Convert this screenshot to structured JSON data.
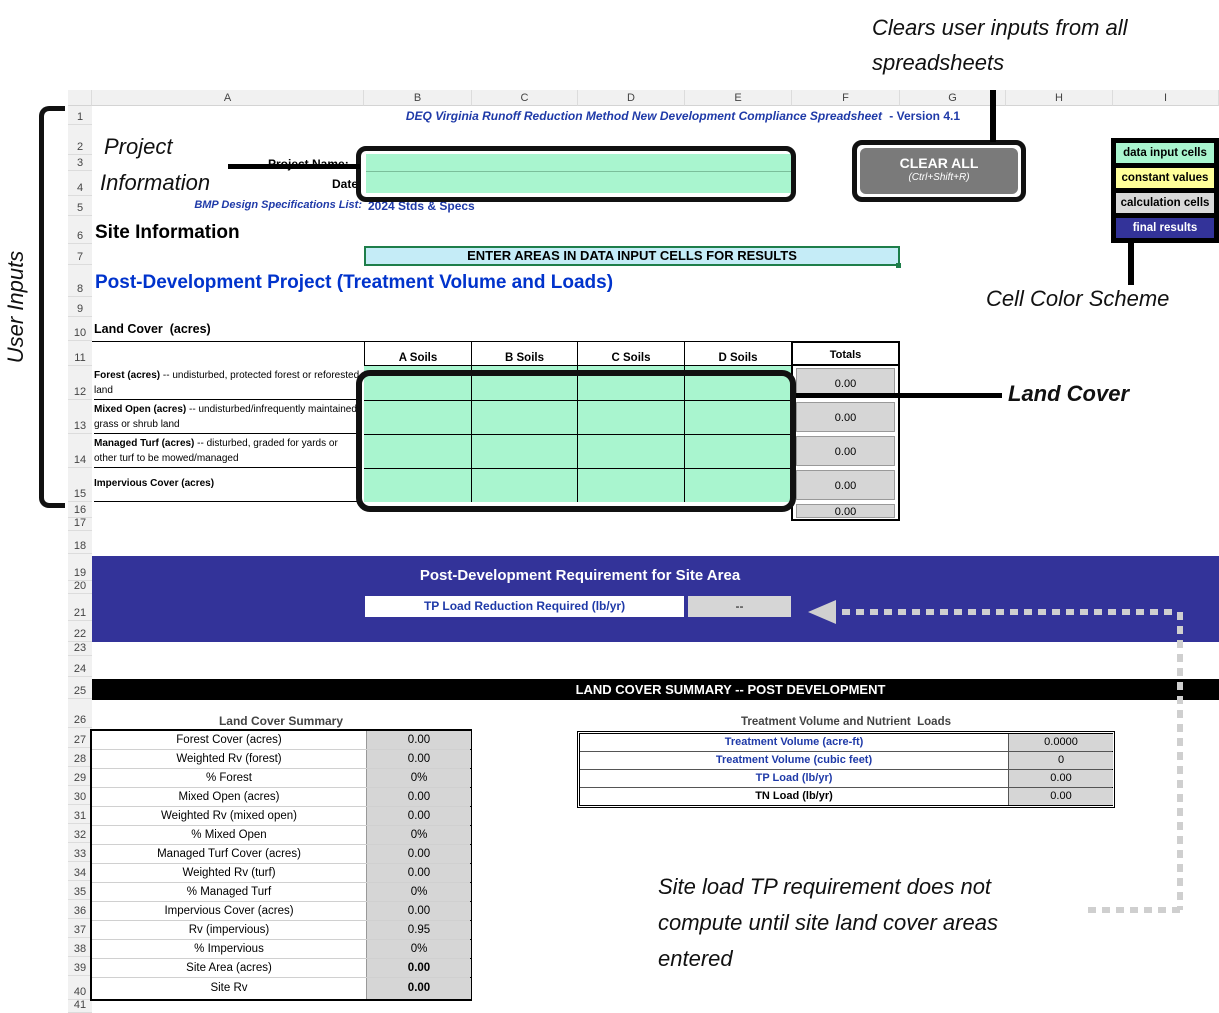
{
  "callouts": {
    "clears": "Clears user inputs from all spreadsheets",
    "project_info_1": "Project",
    "project_info_2": "Information",
    "user_inputs": "User Inputs",
    "land_cover": "Land Cover",
    "cell_color_scheme": "Cell Color Scheme",
    "site_load_1": "Site load TP requirement does not",
    "site_load_2": "compute until site land cover areas",
    "site_load_3": "entered"
  },
  "columns": [
    "A",
    "B",
    "C",
    "D",
    "E",
    "F",
    "G",
    "H",
    "I"
  ],
  "rows": [
    "1",
    "2",
    "3",
    "4",
    "5",
    "6",
    "7",
    "8",
    "9",
    "10",
    "11",
    "12",
    "13",
    "14",
    "15",
    "16",
    "17",
    "18",
    "19",
    "20",
    "21",
    "22",
    "23",
    "24",
    "25",
    "26",
    "27",
    "28",
    "29",
    "30",
    "31",
    "32",
    "33",
    "34",
    "35",
    "36",
    "37",
    "38",
    "39",
    "40",
    "41"
  ],
  "sheet": {
    "title": "DEQ Virginia Runoff Reduction Method New Development Compliance Spreadsheet",
    "version": "- Version 4.1",
    "project_name_label": "Project Name:",
    "date_label": "Date:",
    "bmp_label": "BMP Design Specifications List:",
    "bmp_value": "2024 Stds & Specs",
    "site_info": "Site Information",
    "enter_areas": "ENTER AREAS IN DATA INPUT CELLS FOR RESULTS",
    "post_dev_title": "Post-Development Project (Treatment Volume and Loads)",
    "land_cover_title": "Land Cover  (acres)"
  },
  "clear_all": {
    "label": "CLEAR ALL",
    "shortcut": "(Ctrl+Shift+R)"
  },
  "legend": {
    "input": "data input cells",
    "constant": "constant values",
    "calc": "calculation cells",
    "final": "final results"
  },
  "land_table": {
    "headers": [
      "A Soils",
      "B Soils",
      "C Soils",
      "D Soils",
      "Totals"
    ],
    "rows": [
      {
        "bold": "Forest (acres)",
        "desc": " -- undisturbed, protected forest or reforested land",
        "total": "0.00"
      },
      {
        "bold": "Mixed Open (acres)",
        "desc": " -- undisturbed/infrequently maintained grass or shrub land",
        "total": "0.00"
      },
      {
        "bold": "Managed Turf (acres)",
        "desc": " -- disturbed, graded for yards or other turf to be mowed/managed",
        "total": "0.00"
      },
      {
        "bold": "Impervious Cover (acres)",
        "desc": "",
        "total": "0.00"
      }
    ],
    "grand_total": "0.00"
  },
  "requirement": {
    "title": "Post-Development Requirement for Site Area",
    "label": "TP Load Reduction Required (lb/yr)",
    "value": "--"
  },
  "summary_banner": "LAND COVER SUMMARY -- POST DEVELOPMENT",
  "land_summary": {
    "title": "Land Cover Summary",
    "rows": [
      {
        "label": "Forest Cover (acres)",
        "value": "0.00"
      },
      {
        "label": "Weighted Rv (forest)",
        "value": "0.00"
      },
      {
        "label": "% Forest",
        "value": "0%"
      },
      {
        "label": "Mixed Open (acres)",
        "value": "0.00"
      },
      {
        "label": "Weighted Rv (mixed open)",
        "value": "0.00"
      },
      {
        "label": "% Mixed Open",
        "value": "0%"
      },
      {
        "label": "Managed Turf Cover (acres)",
        "value": "0.00"
      },
      {
        "label": "Weighted Rv (turf)",
        "value": "0.00"
      },
      {
        "label": "% Managed Turf",
        "value": "0%"
      },
      {
        "label": "Impervious Cover (acres)",
        "value": "0.00"
      },
      {
        "label": "Rv (impervious)",
        "value": "0.95"
      },
      {
        "label": "% Impervious",
        "value": "0%"
      },
      {
        "label": "Site Area (acres)",
        "value": "0.00"
      },
      {
        "label": "Site Rv",
        "value": "0.00"
      }
    ]
  },
  "tv_table": {
    "title": "Treatment Volume and Nutrient  Loads",
    "rows": [
      {
        "label": "Treatment Volume (acre-ft)",
        "value": "0.0000"
      },
      {
        "label": "Treatment Volume (cubic feet)",
        "value": "0"
      },
      {
        "label": "TP Load (lb/yr)",
        "value": "0.00"
      },
      {
        "label": "TN Load (lb/yr)",
        "value": "0.00"
      }
    ]
  },
  "colors": {
    "input": "#a9f5cf",
    "constant": "#ffff99",
    "calc": "#d6d6d6",
    "final": "#333399",
    "header_blue": "#0033cc"
  }
}
